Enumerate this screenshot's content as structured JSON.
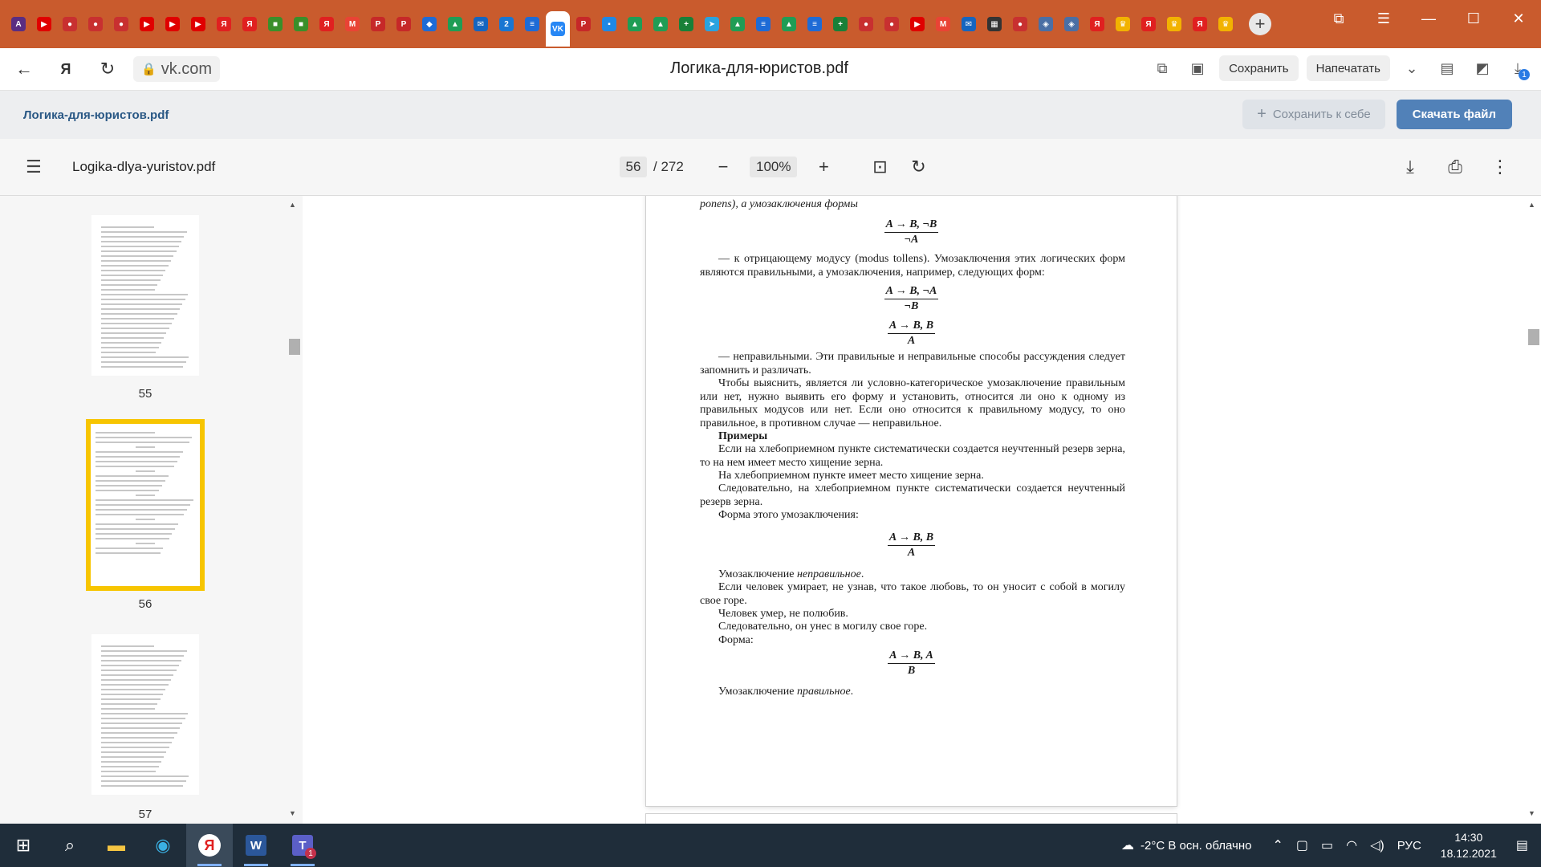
{
  "browser": {
    "tabs": [
      {
        "icon": "translate-icon",
        "color": "#5a2d82",
        "glyph": "A"
      },
      {
        "icon": "youtube-icon",
        "color": "#e00000",
        "glyph": "▶"
      },
      {
        "icon": "pokeball-icon",
        "color": "#c83030",
        "glyph": "●"
      },
      {
        "icon": "pokeball-icon",
        "color": "#c83030",
        "glyph": "●"
      },
      {
        "icon": "pokeball-icon",
        "color": "#c83030",
        "glyph": "●"
      },
      {
        "icon": "youtube-icon",
        "color": "#e00000",
        "glyph": "▶"
      },
      {
        "icon": "youtube-icon",
        "color": "#e00000",
        "glyph": "▶"
      },
      {
        "icon": "youtube-icon",
        "color": "#e00000",
        "glyph": "▶"
      },
      {
        "icon": "yandex-icon",
        "color": "#e02020",
        "glyph": "Я"
      },
      {
        "icon": "yandex-icon",
        "color": "#e02020",
        "glyph": "Я"
      },
      {
        "icon": "microsoft-icon",
        "color": "#3a8f2a",
        "glyph": "■"
      },
      {
        "icon": "microsoft-icon",
        "color": "#3a8f2a",
        "glyph": "■"
      },
      {
        "icon": "yandex-icon",
        "color": "#e02020",
        "glyph": "Я"
      },
      {
        "icon": "gmail-icon",
        "color": "#e94335",
        "glyph": "M"
      },
      {
        "icon": "pdf-icon",
        "color": "#c62828",
        "glyph": "P"
      },
      {
        "icon": "pdf-icon",
        "color": "#c62828",
        "glyph": "P"
      },
      {
        "icon": "dropbox-icon",
        "color": "#1e6bd6",
        "glyph": "◆"
      },
      {
        "icon": "google-drive-icon",
        "color": "#1f9d55",
        "glyph": "▲"
      },
      {
        "icon": "mail-icon",
        "color": "#1565c0",
        "glyph": "✉"
      },
      {
        "icon": "number-two-icon",
        "color": "#1976d2",
        "glyph": "2"
      },
      {
        "icon": "docs-icon",
        "color": "#1e6bd6",
        "glyph": "≡"
      },
      {
        "icon": "vk-icon",
        "color": "#2787f5",
        "glyph": "VK"
      },
      {
        "icon": "pdf-icon",
        "color": "#c62828",
        "glyph": "P"
      },
      {
        "icon": "chat-icon",
        "color": "#1e88e5",
        "glyph": "▪"
      },
      {
        "icon": "google-drive-icon",
        "color": "#1f9d55",
        "glyph": "▲"
      },
      {
        "icon": "google-drive-icon",
        "color": "#1f9d55",
        "glyph": "▲"
      },
      {
        "icon": "sheets-icon",
        "color": "#188038",
        "glyph": "+"
      },
      {
        "icon": "telegram-icon",
        "color": "#2aa3df",
        "glyph": "➤"
      },
      {
        "icon": "google-drive-icon",
        "color": "#1f9d55",
        "glyph": "▲"
      },
      {
        "icon": "docs-icon",
        "color": "#1e6bd6",
        "glyph": "≡"
      },
      {
        "icon": "google-drive-icon",
        "color": "#1f9d55",
        "glyph": "▲"
      },
      {
        "icon": "docs-icon",
        "color": "#1e6bd6",
        "glyph": "≡"
      },
      {
        "icon": "sheets-icon",
        "color": "#188038",
        "glyph": "+"
      },
      {
        "icon": "pokeball-icon",
        "color": "#c83030",
        "glyph": "●"
      },
      {
        "icon": "pokeball-icon",
        "color": "#c83030",
        "glyph": "●"
      },
      {
        "icon": "youtube-icon",
        "color": "#e00000",
        "glyph": "▶"
      },
      {
        "icon": "gmail-icon",
        "color": "#e94335",
        "glyph": "M"
      },
      {
        "icon": "mail-icon",
        "color": "#1565c0",
        "glyph": "✉"
      },
      {
        "icon": "table-icon",
        "color": "#333333",
        "glyph": "▦"
      },
      {
        "icon": "pokeball-icon",
        "color": "#c83030",
        "glyph": "●"
      },
      {
        "icon": "shield-icon",
        "color": "#4a6fa5",
        "glyph": "◈"
      },
      {
        "icon": "shield-icon",
        "color": "#4a6fa5",
        "glyph": "◈"
      },
      {
        "icon": "yandex-icon",
        "color": "#e02020",
        "glyph": "Я"
      },
      {
        "icon": "crown-icon",
        "color": "#f2b200",
        "glyph": "♛"
      },
      {
        "icon": "yandex-icon",
        "color": "#e02020",
        "glyph": "Я"
      },
      {
        "icon": "crown-icon",
        "color": "#f2b200",
        "glyph": "♛"
      },
      {
        "icon": "yandex-icon",
        "color": "#e02020",
        "glyph": "Я"
      },
      {
        "icon": "crown-icon",
        "color": "#f2b200",
        "glyph": "♛"
      }
    ],
    "active_tab_index": 21,
    "url": "vk.com",
    "page_title": "Логика-для-юристов.pdf",
    "save_label": "Сохранить",
    "print_label": "Напечатать",
    "download_badge": "1",
    "tabstrip_color": "#c95b2d"
  },
  "vk": {
    "filename": "Логика-для-юристов.pdf",
    "save_to_me": "Сохранить к себе",
    "download": "Скачать файл"
  },
  "pdf": {
    "filename": "Logika-dlya-yuristov.pdf",
    "current_page": "56",
    "total_pages": "/ 272",
    "zoom": "100%",
    "thumbnails": [
      {
        "label": "55",
        "selected": false
      },
      {
        "label": "56",
        "selected": true
      },
      {
        "label": "57",
        "selected": false
      }
    ],
    "page": {
      "p_top": "ponens), а умозаключения формы",
      "f1_num": "A → B, ¬B",
      "f1_den": "¬A",
      "p1": "— к отрицающему модусу (modus tollens). Умозаключения этих логических форм являются правильными, а умозаключения, например, следующих форм:",
      "f2_num": "A → B, ¬A",
      "f2_den": "¬B",
      "f3_num": "A → B, B",
      "f3_den": "A",
      "p2": "— неправильными. Эти правильные и неправильные способы рассуждения следует запомнить и различать.",
      "p3": "Чтобы выяснить, является ли условно-категорическое умозаключение правильным или нет, нужно выявить его форму и установить, относится ли оно к одному из правильных модусов или нет. Если оно относится к правильному модусу, то оно правильное, в противном случае — неправильное.",
      "examples_heading": "Примеры",
      "p4": "Если на хлебоприемном пункте систематически создается неучтенный резерв зерна, то на нем имеет место хищение зерна.",
      "p5": "На хлебоприемном пункте имеет место хищение зерна.",
      "p6": "Следовательно, на хлебоприемном пункте систематически создается неучтенный резерв зерна.",
      "p7": "Форма этого умозаключения:",
      "f4_num": "A → B, B",
      "f4_den": "A",
      "p8_prefix": "Умозаключение ",
      "p8_em": "неправильное",
      "p8_suffix": ".",
      "p9": "Если человек умирает, не узнав, что такое любовь, то он уносит с собой в могилу свое горе.",
      "p10": "Человек умер, не полюбив.",
      "p11": "Следовательно, он унес в могилу свое горе.",
      "p12": "Форма:",
      "f5_num": "A → B, A",
      "f5_den": "B",
      "p13_prefix": "Умозаключение ",
      "p13_em": "правильное",
      "p13_suffix": "."
    }
  },
  "taskbar": {
    "weather": "-2°C  В осн. облачно",
    "lang": "РУС",
    "time": "14:30",
    "date": "18.12.2021",
    "teams_badge": "1"
  }
}
